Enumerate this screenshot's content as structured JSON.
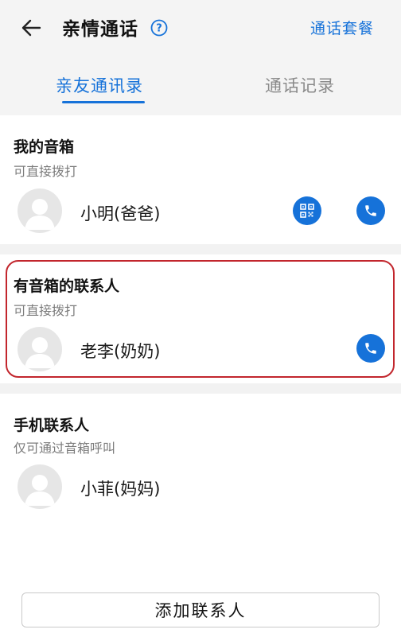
{
  "header": {
    "title": "亲情通话",
    "plan_link": "通话套餐",
    "back_icon": "arrow-left-icon",
    "help_icon": "question-circle-icon"
  },
  "tabs": [
    {
      "label": "亲友通讯录",
      "active": true
    },
    {
      "label": "通话记录",
      "active": false
    }
  ],
  "sections": [
    {
      "title": "我的音箱",
      "subtitle": "可直接拨打",
      "contacts": [
        {
          "name": "小明(爸爸)",
          "actions": [
            "qr-code-icon",
            "phone-icon"
          ]
        }
      ]
    },
    {
      "title": "有音箱的联系人",
      "subtitle": "可直接拨打",
      "highlighted": true,
      "contacts": [
        {
          "name": "老李(奶奶)",
          "actions": [
            "phone-icon"
          ]
        }
      ]
    },
    {
      "title": "手机联系人",
      "subtitle": "仅可通过音箱呼叫",
      "contacts": [
        {
          "name": "小菲(妈妈)",
          "actions": []
        }
      ]
    }
  ],
  "footer": {
    "add_button": "添加联系人"
  },
  "colors": {
    "accent": "#1672d9",
    "highlight_border": "#c2262d",
    "header_bg": "#f4f4f4"
  }
}
